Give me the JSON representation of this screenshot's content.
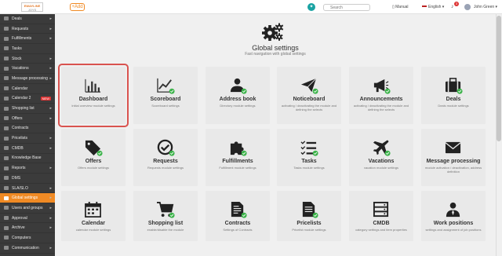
{
  "header": {
    "logo_line1": "EWAYLINE",
    "logo_line2": "JOYS",
    "add_label": "+Add",
    "search_placeholder": "Search",
    "manual_label": "Manual",
    "language": "English",
    "notifications_count": "3",
    "user_name": "John Green"
  },
  "sidebar": {
    "items": [
      {
        "label": "Deals",
        "arrow": true
      },
      {
        "label": "Requests",
        "arrow": true
      },
      {
        "label": "Fulfillments",
        "arrow": true
      },
      {
        "label": "Tasks",
        "arrow": false
      },
      {
        "label": "Stock",
        "arrow": true
      },
      {
        "label": "Vacations",
        "arrow": true
      },
      {
        "label": "Message processing",
        "arrow": true
      },
      {
        "label": "Calendar",
        "arrow": false
      },
      {
        "label": "Calendar 2",
        "arrow": false,
        "badge": "NEW"
      },
      {
        "label": "Shopping list",
        "arrow": true
      },
      {
        "label": "Offers",
        "arrow": true
      },
      {
        "label": "Contracts",
        "arrow": false
      },
      {
        "label": "Pricelists",
        "arrow": true
      },
      {
        "label": "CMDB",
        "arrow": true
      },
      {
        "label": "Knowledge Base",
        "arrow": false
      },
      {
        "label": "Reports",
        "arrow": true
      },
      {
        "label": "DMS",
        "arrow": false
      },
      {
        "label": "SLA/SLO",
        "arrow": true
      },
      {
        "label": "Global settings",
        "arrow": true,
        "active": true
      },
      {
        "label": "Users and groups",
        "arrow": true
      },
      {
        "label": "Approval",
        "arrow": true
      },
      {
        "label": "Archive",
        "arrow": true
      },
      {
        "label": "Computers",
        "arrow": false
      },
      {
        "label": "Communication",
        "arrow": true
      }
    ]
  },
  "main": {
    "title": "Global settings",
    "subtitle": "Fast navigation with global settings",
    "tiles": [
      {
        "title": "Dashboard",
        "desc": "Initial overview module settings",
        "icon": "bar-chart-icon",
        "check": false,
        "selected": true
      },
      {
        "title": "Scoreboard",
        "desc": "Scoreboard settings",
        "icon": "line-chart-icon",
        "check": true
      },
      {
        "title": "Address book",
        "desc": "Directory module settings",
        "icon": "people-icon",
        "check": true
      },
      {
        "title": "Noticeboard",
        "desc": "activating / deactivating the module and defining the selects",
        "icon": "paper-plane-icon",
        "check": true
      },
      {
        "title": "Announcements",
        "desc": "activating / deactivating the module and defining the selects",
        "icon": "megaphone-icon",
        "check": true
      },
      {
        "title": "Deals",
        "desc": "Deals module settings",
        "icon": "briefcase-icon",
        "check": true
      },
      {
        "title": "Offers",
        "desc": "Offers module settings",
        "icon": "tags-icon",
        "check": true
      },
      {
        "title": "Requests",
        "desc": "Requests module settings",
        "icon": "check-circle-icon",
        "check": true
      },
      {
        "title": "Fulfillments",
        "desc": "Fulfillment module settings",
        "icon": "puzzle-icon",
        "check": true
      },
      {
        "title": "Tasks",
        "desc": "Tasks module settings",
        "icon": "task-list-icon",
        "check": true
      },
      {
        "title": "Vacations",
        "desc": "vacation module settings",
        "icon": "airplane-icon",
        "check": true
      },
      {
        "title": "Message processing",
        "desc": "module activation / deactivation, address definition",
        "icon": "envelope-icon",
        "check": false
      },
      {
        "title": "Calendar",
        "desc": "calendar module settings",
        "icon": "calendar-icon",
        "check": false
      },
      {
        "title": "Shopping list",
        "desc": "enable/disable the module",
        "icon": "cart-icon",
        "check": true
      },
      {
        "title": "Contracts",
        "desc": "Settings of Contracts",
        "icon": "contract-icon",
        "check": true
      },
      {
        "title": "Pricelists",
        "desc": "Pricelist module settings",
        "icon": "pricelist-icon",
        "check": true
      },
      {
        "title": "CMDB",
        "desc": "category settings and item properties",
        "icon": "cmdb-icon",
        "check": false
      },
      {
        "title": "Work positions",
        "desc": "settings and assignment of job positions",
        "icon": "work-positions-icon",
        "check": false
      }
    ]
  },
  "colors": {
    "accent": "#f08a24",
    "sidebar": "#3b3b3b",
    "check": "#3cb34a",
    "selection": "#d9534f"
  }
}
